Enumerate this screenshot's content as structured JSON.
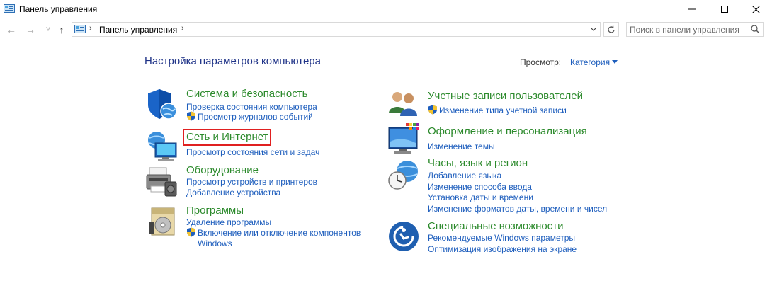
{
  "window": {
    "title": "Панель управления",
    "controls": {
      "minimize": "—",
      "maximize": "☐",
      "close": "✕"
    }
  },
  "nav": {
    "back": "←",
    "forward": "→",
    "recent": "˅",
    "up": "↑"
  },
  "address": {
    "separator": "›",
    "path": "Панель управления"
  },
  "search": {
    "placeholder": "Поиск в панели управления"
  },
  "content": {
    "heading": "Настройка параметров компьютера",
    "view_label": "Просмотр:",
    "view_value": "Категория"
  },
  "categories": [
    {
      "title": "Система и безопасность",
      "icon": "shield-globe-icon",
      "links": [
        {
          "text": "Проверка состояния компьютера",
          "shield": false
        },
        {
          "text": "Просмотр журналов событий",
          "shield": true
        }
      ]
    },
    {
      "title": "Сеть и Интернет",
      "icon": "network-globe-icon",
      "highlighted": true,
      "highlight_color": "#e02020",
      "links": [
        {
          "text": "Просмотр состояния сети и задач",
          "shield": false
        }
      ]
    },
    {
      "title": "Оборудование",
      "icon": "printer-icon",
      "links": [
        {
          "text": "Просмотр устройств и принтеров",
          "shield": false
        },
        {
          "text": "Добавление устройства",
          "shield": false
        }
      ]
    },
    {
      "title": "Программы",
      "icon": "programs-disc-icon",
      "links": [
        {
          "text": "Удаление программы",
          "shield": false
        },
        {
          "text": "Включение или отключение компонентов",
          "shield": true,
          "continuation": "Windows"
        }
      ]
    },
    {
      "title": "Учетные записи пользователей",
      "icon": "users-icon",
      "links": [
        {
          "text": "Изменение типа учетной записи",
          "shield": true
        }
      ]
    },
    {
      "title": "Оформление и персонализация",
      "icon": "monitor-palette-icon",
      "links": [
        {
          "text": "Изменение темы",
          "shield": false
        }
      ]
    },
    {
      "title": "Часы, язык и регион",
      "icon": "clock-globe-icon",
      "links": [
        {
          "text": "Добавление языка",
          "shield": false
        },
        {
          "text": "Изменение способа ввода",
          "shield": false
        },
        {
          "text": "Установка даты и времени",
          "shield": false
        },
        {
          "text": "Изменение форматов даты, времени и чисел",
          "shield": false
        }
      ]
    },
    {
      "title": "Специальные возможности",
      "icon": "accessibility-icon",
      "links": [
        {
          "text": "Рекомендуемые Windows параметры",
          "shield": false
        },
        {
          "text": "Оптимизация изображения на экране",
          "shield": false
        }
      ]
    }
  ],
  "colors": {
    "category_title": "#2c8a2c",
    "link": "#1e5ebd",
    "heading": "#1e3287"
  }
}
